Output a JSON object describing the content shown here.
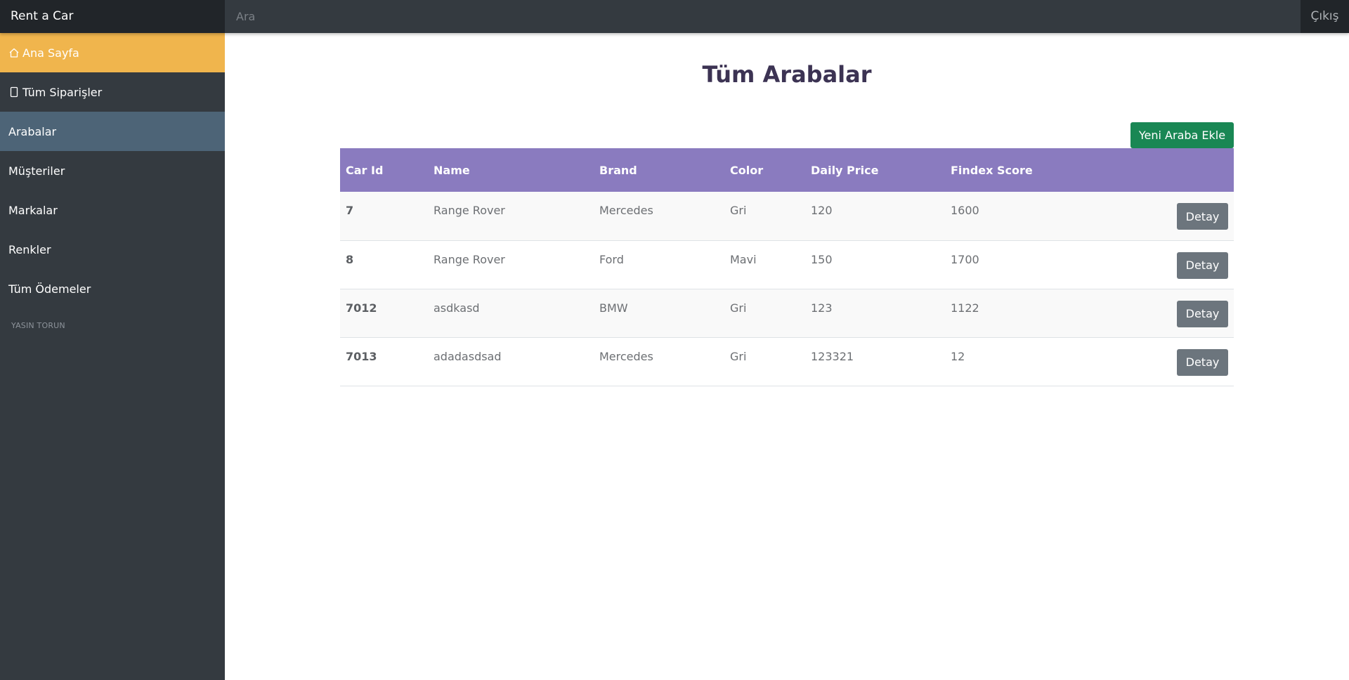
{
  "navbar": {
    "brand": "Rent a Car",
    "search_placeholder": "Ara",
    "logout": "Çıkış"
  },
  "sidebar": {
    "items": [
      {
        "label": "Ana Sayfa",
        "icon": "home-icon"
      },
      {
        "label": "Tüm Siparişler",
        "icon": "phone-icon"
      },
      {
        "label": "Arabalar"
      },
      {
        "label": "Müşteriler"
      },
      {
        "label": "Markalar"
      },
      {
        "label": "Renkler"
      },
      {
        "label": "Tüm Ödemeler"
      }
    ],
    "footer": "YASIN TORUN"
  },
  "main": {
    "title": "Tüm Arabalar",
    "add_button": "Yeni Araba Ekle",
    "table": {
      "headers": [
        "Car Id",
        "Name",
        "Brand",
        "Color",
        "Daily Price",
        "Findex Score"
      ],
      "rows": [
        {
          "id": "7",
          "name": "Range Rover",
          "brand": "Mercedes",
          "color": "Gri",
          "price": "120",
          "findex": "1600",
          "action": "Detay"
        },
        {
          "id": "8",
          "name": "Range Rover",
          "brand": "Ford",
          "color": "Mavi",
          "price": "150",
          "findex": "1700",
          "action": "Detay"
        },
        {
          "id": "7012",
          "name": "asdkasd",
          "brand": "BMW",
          "color": "Gri",
          "price": "123",
          "findex": "1122",
          "action": "Detay"
        },
        {
          "id": "7013",
          "name": "adadasdsad",
          "brand": "Mercedes",
          "color": "Gri",
          "price": "123321",
          "findex": "12",
          "action": "Detay"
        }
      ]
    }
  },
  "colors": {
    "navbar_bg": "#343a40",
    "active_home": "#f0b54d",
    "active_cars": "#4d6477",
    "table_header": "#8a7bbf",
    "add_button": "#198754",
    "detail_button": "#6c757d"
  }
}
